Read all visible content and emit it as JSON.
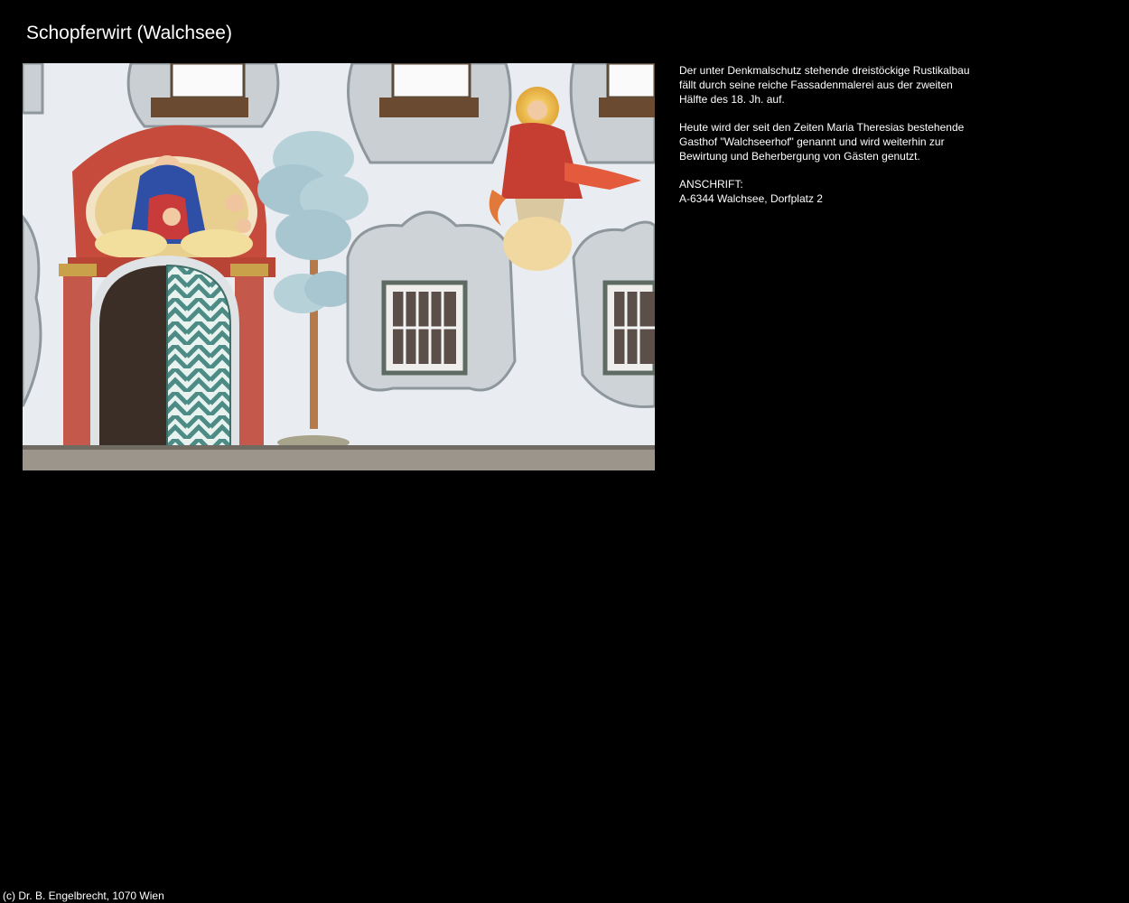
{
  "page": {
    "title": "Schopferwirt (Walchsee)",
    "background": "#000000",
    "text_color": "#ffffff"
  },
  "photo": {
    "subject": "painted-facade-photo"
  },
  "description": {
    "paragraph1_line1": "Der unter Denkmalschutz stehende dreistöckige Rustikalbau",
    "paragraph1_line2": "fällt durch seine reiche Fassadenmalerei aus der zweiten",
    "paragraph1_line3": "Hälfte des 18. Jh. auf.",
    "paragraph2_line1": "Heute wird der seit den Zeiten Maria Theresias bestehende",
    "paragraph2_line2": "Gasthof \"Walchseerhof\" genannt und wird weiterhin zur",
    "paragraph2_line3": "Bewirtung und Beherbergung von Gästen genutzt.",
    "address_label": "ANSCHRIFT:",
    "address_value": "A-6344 Walchsee, Dorfplatz 2"
  },
  "footer": {
    "copyright": "(c) Dr. B. Engelbrecht, 1070 Wien"
  }
}
